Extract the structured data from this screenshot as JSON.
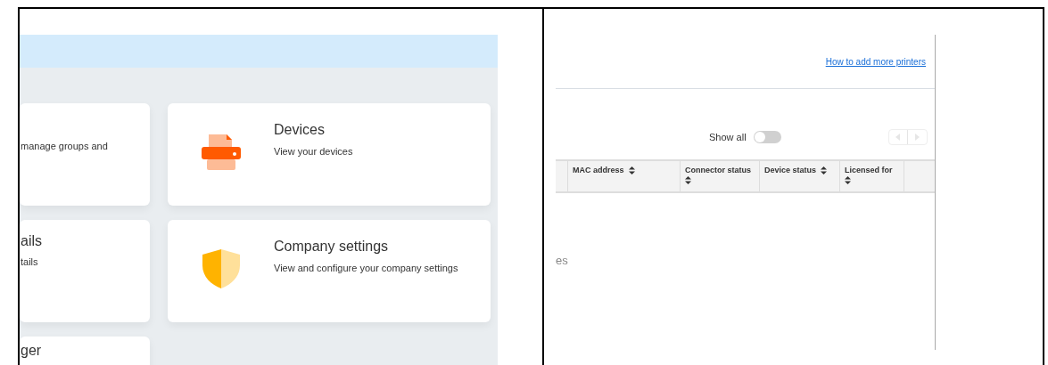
{
  "dashboard": {
    "cards": [
      {
        "kind": "partial",
        "description": "manage groups and"
      },
      {
        "kind": "partial",
        "title": "ails",
        "description": "tails"
      },
      {
        "kind": "partial",
        "title": "ger"
      },
      {
        "kind": "devices",
        "title": "Devices",
        "description": "View your devices"
      },
      {
        "kind": "settings",
        "title": "Company settings",
        "description": "View and configure your company settings"
      }
    ]
  },
  "printers": {
    "help_link": "How to add more printers",
    "show_all": {
      "label": "Show all",
      "on": false
    },
    "pagination": {
      "prev_disabled": true,
      "next_disabled": true
    },
    "table": {
      "columns": [
        {
          "sortable": false
        },
        {
          "label": "MAC address",
          "sortable": true
        },
        {
          "label": "Connector status",
          "sortable": true
        },
        {
          "label": "Device status",
          "sortable": true
        },
        {
          "label": "Licensed for",
          "sortable": true
        },
        {
          "sortable": false
        }
      ]
    },
    "empty_text": "es"
  }
}
